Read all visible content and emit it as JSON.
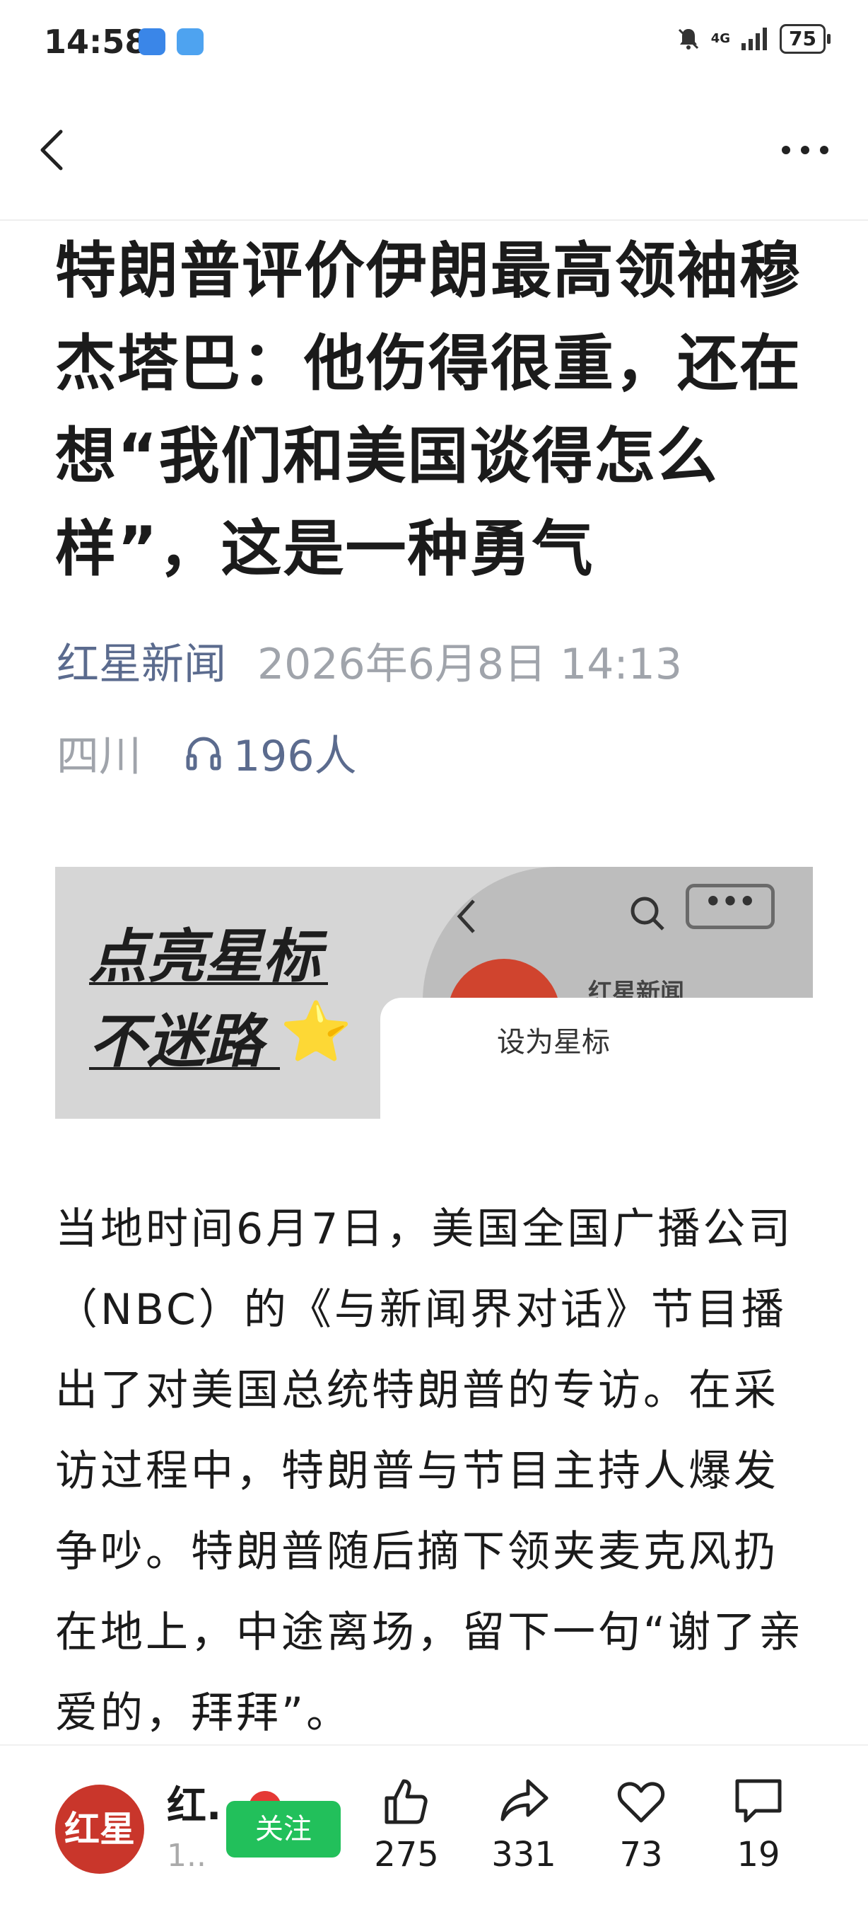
{
  "status_bar": {
    "time": "14:58",
    "network": "4G",
    "battery": "75"
  },
  "article": {
    "title": "特朗普评价伊朗最高领袖穆杰塔巴：他伤得很重，还在想“我们和美国谈得怎么样”，这是一种勇气",
    "source": "红星新闻",
    "datetime": "2026年6月8日 14:13",
    "location": "四川",
    "listen_count": "196人",
    "body": "当地时间6月7日，美国全国广播公司（NBC）的《与新闻界对话》节目播出了对美国总统特朗普的专访。在采访过程中，特朗普与节目主持人爆发争吵。特朗普随后摘下领夹麦克风扔在地上，中途离场，留下一句“谢了亲爱的，拜拜”。"
  },
  "banner": {
    "slogan_line1": "点亮星标",
    "slogan_line2": "不迷路",
    "star_emoji": "⭐",
    "account_name": "红星新闻",
    "sheet_label": "设为星标"
  },
  "bottom_bar": {
    "avatar_text": "红星",
    "account_name": "红.",
    "account_sub": "1..",
    "follow_label": "关注",
    "likes": "275",
    "shares": "331",
    "favorites": "73",
    "comments": "19"
  },
  "colors": {
    "follow_green": "#22c05b",
    "source_blue": "#5b6b8e",
    "avatar_red": "#c9362b"
  }
}
